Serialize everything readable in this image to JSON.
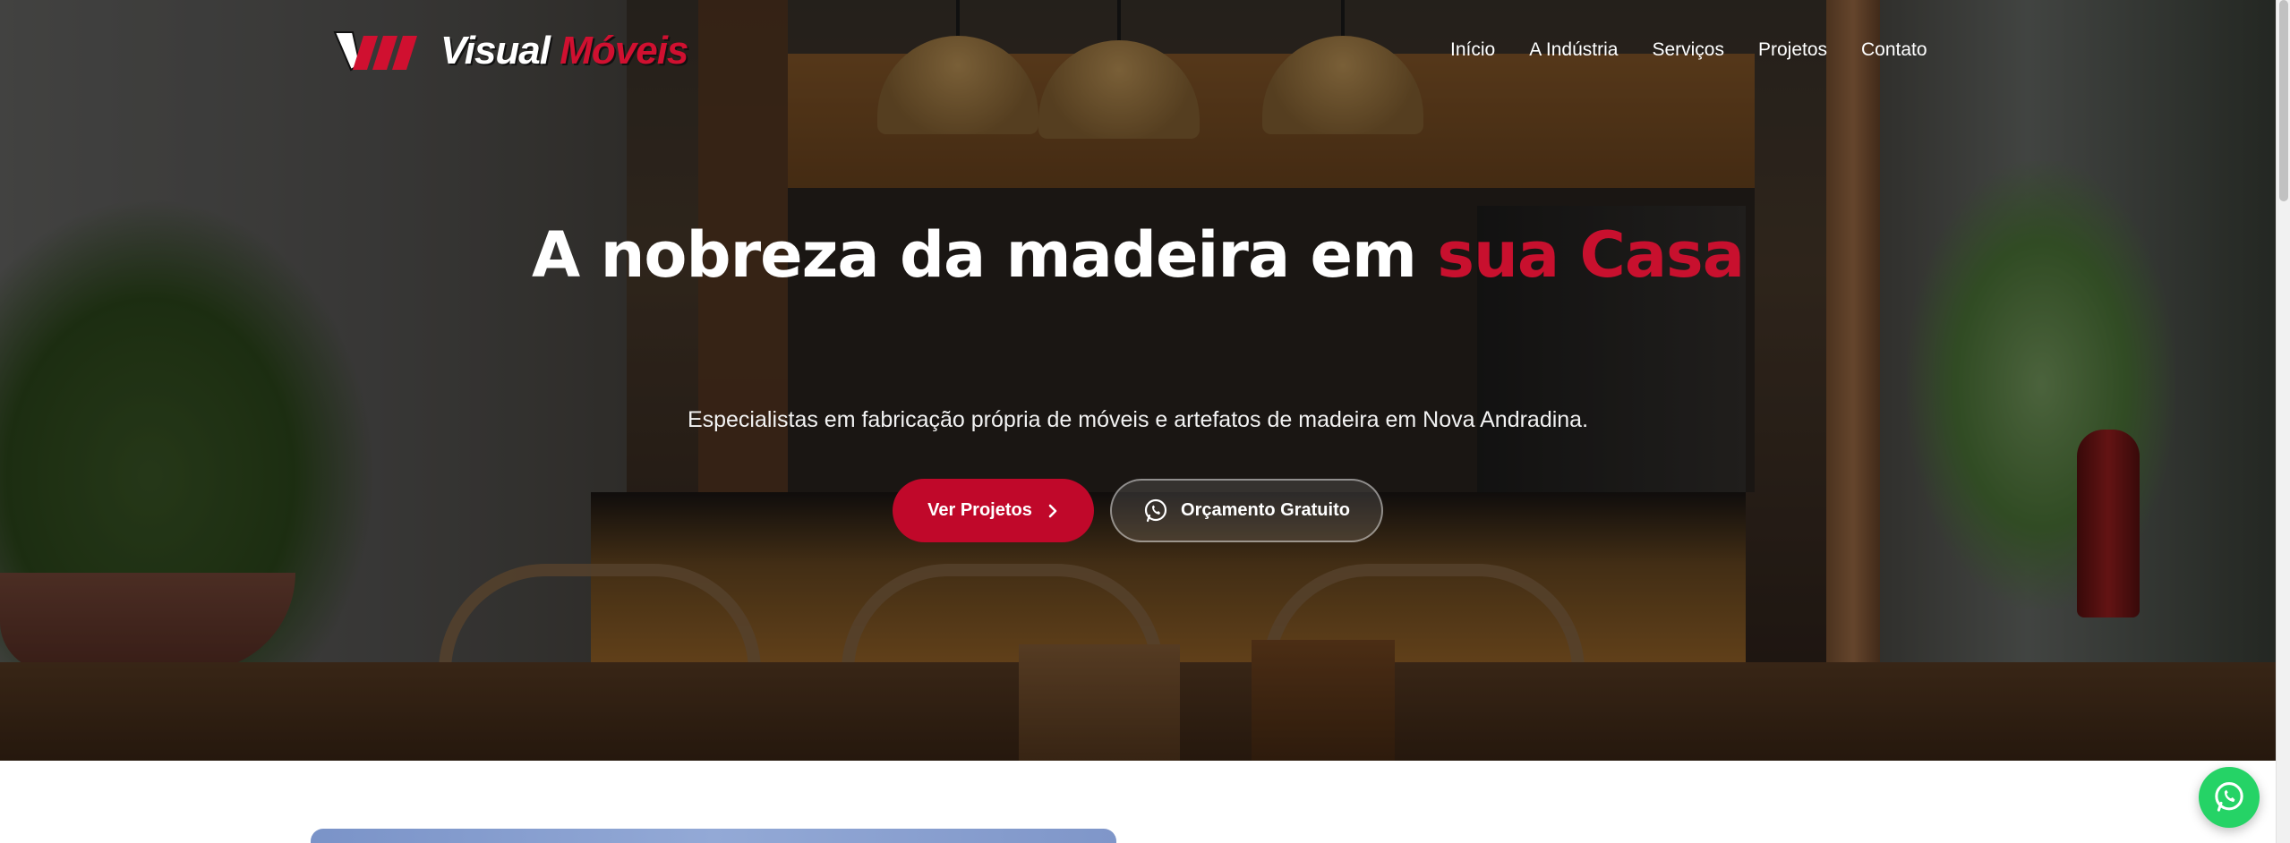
{
  "brand": {
    "name_part1": "Visual",
    "name_part2": "Móveis",
    "accent_color": "#c8102e"
  },
  "nav": {
    "items": [
      {
        "label": "Início"
      },
      {
        "label": "A Indústria"
      },
      {
        "label": "Serviços"
      },
      {
        "label": "Projetos"
      },
      {
        "label": "Contato"
      }
    ]
  },
  "hero": {
    "headline_main": "A nobreza da madeira em ",
    "headline_accent": "sua Casa",
    "subtitle": "Especialistas em fabricação própria de móveis e artefatos de madeira em Nova Andradina.",
    "primary_button": {
      "label": "Ver Projetos",
      "icon": "chevron-right-icon"
    },
    "secondary_button": {
      "label": "Orçamento Gratuito",
      "icon": "whatsapp-icon"
    }
  },
  "floating": {
    "whatsapp_icon": "whatsapp-icon",
    "whatsapp_color": "#25d366"
  }
}
